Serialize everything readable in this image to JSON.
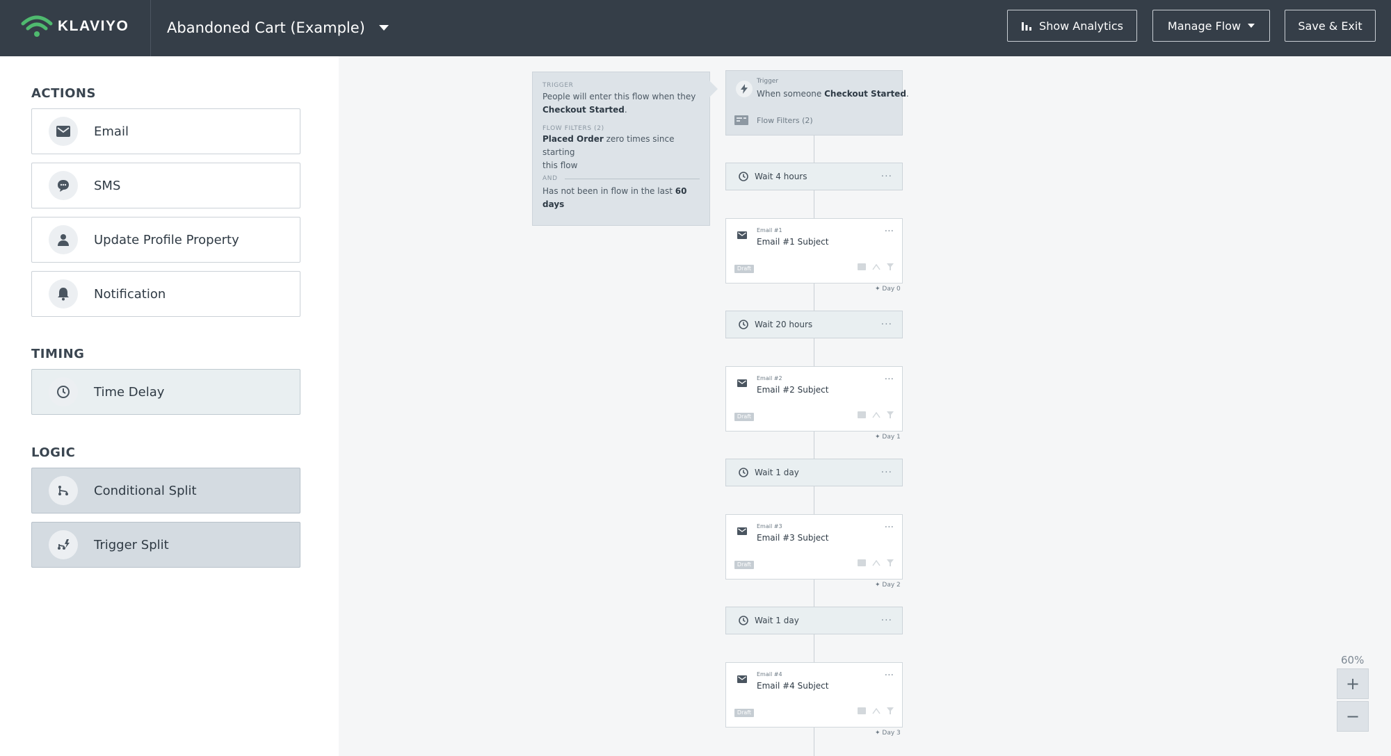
{
  "header": {
    "logo_text": "KLAVIYO",
    "flow_name": "Abandoned Cart (Example)",
    "buttons": {
      "analytics": "Show Analytics",
      "manage": "Manage Flow",
      "save": "Save & Exit"
    }
  },
  "sidebar": {
    "actions_heading": "ACTIONS",
    "actions": [
      {
        "label": "Email",
        "icon": "envelope-icon"
      },
      {
        "label": "SMS",
        "icon": "chat-bubble-icon"
      },
      {
        "label": "Update Profile Property",
        "icon": "person-icon"
      },
      {
        "label": "Notification",
        "icon": "bell-icon"
      }
    ],
    "timing_heading": "TIMING",
    "timing": [
      {
        "label": "Time Delay",
        "icon": "clock-icon"
      }
    ],
    "logic_heading": "LOGIC",
    "logic": [
      {
        "label": "Conditional Split",
        "icon": "split-icon"
      },
      {
        "label": "Trigger Split",
        "icon": "trigger-split-icon"
      }
    ]
  },
  "info_card": {
    "trigger_label": "TRIGGER",
    "trigger_text_1": "People will enter this flow when they",
    "trigger_event": "Checkout Started",
    "filters_label": "FLOW FILTERS (2)",
    "filter1_metric": "Placed Order",
    "filter1_rest_1": " zero times since starting",
    "filter1_rest_2": "this flow",
    "and_label": "AND",
    "filter2_text": "Has not been in flow in the last ",
    "filter2_value": "60",
    "filter2_unit": "days"
  },
  "trigger_card": {
    "label": "Trigger",
    "text": "When someone ",
    "event": "Checkout Started",
    "filters": "Flow Filters (2)"
  },
  "flow": {
    "waits": [
      "Wait 4 hours",
      "Wait 20 hours",
      "Wait 1 day",
      "Wait 1 day"
    ],
    "emails": [
      {
        "small": "Email #1",
        "subject": "Email #1 Subject",
        "status": "Draft",
        "day": "Day 0"
      },
      {
        "small": "Email #2",
        "subject": "Email #2 Subject",
        "status": "Draft",
        "day": "Day 1"
      },
      {
        "small": "Email #3",
        "subject": "Email #3 Subject",
        "status": "Draft",
        "day": "Day 2"
      },
      {
        "small": "Email #4",
        "subject": "Email #4 Subject",
        "status": "Draft",
        "day": "Day 3"
      }
    ],
    "dots": "···",
    "day_prefix": "✦ "
  },
  "zoom": {
    "level": "60%",
    "plus": "+",
    "minus": "−"
  },
  "colors": {
    "header_bg": "#353e48",
    "logo_green": "#4fba6f",
    "canvas_bg": "#f5f6f7"
  }
}
